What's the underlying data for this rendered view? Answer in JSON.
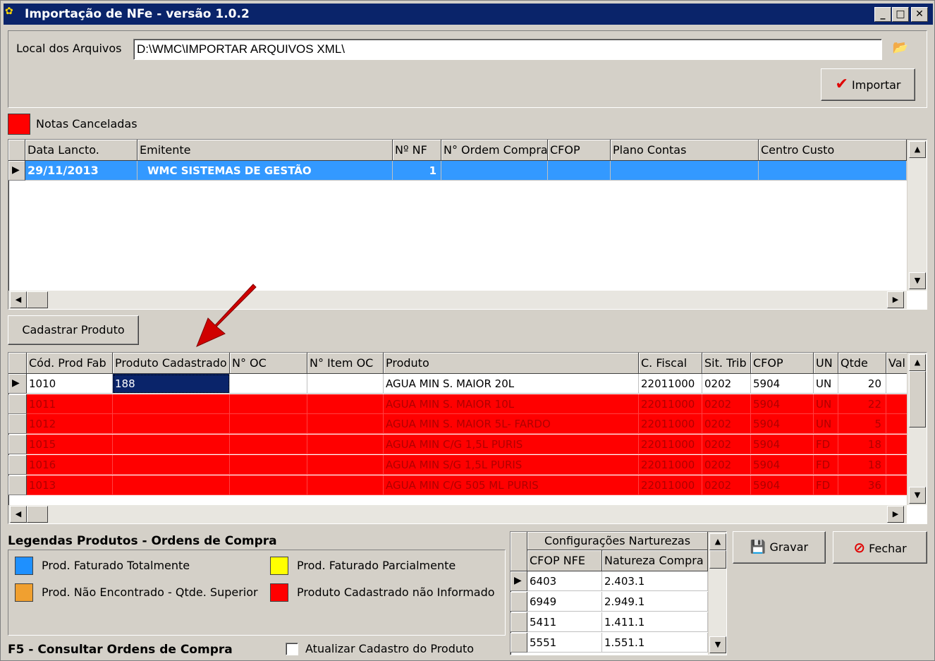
{
  "window": {
    "title": "Importação de NFe - versão 1.0.2",
    "controls": {
      "minimize": "_",
      "maximize": "□",
      "close": "✕"
    }
  },
  "path": {
    "label": "Local dos Arquivos",
    "value": "D:\\WMC\\IMPORTAR ARQUIVOS XML\\"
  },
  "buttons": {
    "importar": "Importar",
    "cadastrar": "Cadastrar Produto",
    "gravar": "Gravar",
    "fechar": "Fechar"
  },
  "canceled_legend": {
    "label": "Notas Canceladas",
    "color": "#ff0000"
  },
  "notes_grid": {
    "columns": [
      "Data Lancto.",
      "Emitente",
      "Nº NF",
      "N° Ordem Compra",
      "CFOP",
      "Plano Contas",
      "Centro Custo"
    ],
    "rows": [
      {
        "data": "29/11/2013",
        "emitente": "WMC SISTEMAS DE GESTÃO",
        "nf": "1",
        "ordem": "",
        "cfop": "",
        "plano": "",
        "centro": ""
      }
    ]
  },
  "products_grid": {
    "columns": [
      "Cód. Prod Fab",
      "Produto Cadastrado",
      "N° OC",
      "N° Item OC",
      "Produto",
      "C. Fiscal",
      "Sit. Trib",
      "CFOP",
      "UN",
      "Qtde",
      "Val"
    ],
    "rows": [
      {
        "cod": "1010",
        "cad": "188",
        "oc": "",
        "item": "",
        "produto": "AGUA MIN S. MAIOR 20L",
        "fiscal": "22011000",
        "sit": "0202",
        "cfop": "5904",
        "un": "UN",
        "qtde": "20"
      },
      {
        "cod": "1011",
        "cad": "",
        "oc": "",
        "item": "",
        "produto": "AGUA MIN S. MAIOR 10L",
        "fiscal": "22011000",
        "sit": "0202",
        "cfop": "5904",
        "un": "UN",
        "qtde": "22"
      },
      {
        "cod": "1012",
        "cad": "",
        "oc": "",
        "item": "",
        "produto": "AGUA MIN S. MAIOR 5L- FARDO",
        "fiscal": "22011000",
        "sit": "0202",
        "cfop": "5904",
        "un": "UN",
        "qtde": "5"
      },
      {
        "cod": "1015",
        "cad": "",
        "oc": "",
        "item": "",
        "produto": "AGUA MIN C/G 1,5L PURIS",
        "fiscal": "22011000",
        "sit": "0202",
        "cfop": "5904",
        "un": "FD",
        "qtde": "18"
      },
      {
        "cod": "1016",
        "cad": "",
        "oc": "",
        "item": "",
        "produto": "AGUA MIN S/G 1,5L PURIS",
        "fiscal": "22011000",
        "sit": "0202",
        "cfop": "5904",
        "un": "FD",
        "qtde": "18"
      },
      {
        "cod": "1013",
        "cad": "",
        "oc": "",
        "item": "",
        "produto": "AGUA MIN C/G 505 ML PURIS",
        "fiscal": "22011000",
        "sit": "0202",
        "cfop": "5904",
        "un": "FD",
        "qtde": "36"
      }
    ]
  },
  "legend": {
    "title": "Legendas Produtos - Ordens de Compra",
    "items": [
      {
        "label": "Prod. Faturado Totalmente",
        "color": "#1e90ff"
      },
      {
        "label": "Prod. Faturado Parcialmente",
        "color": "#ffff00"
      },
      {
        "label": "Prod. Não Encontrado - Qtde. Superior",
        "color": "#f0a030"
      },
      {
        "label": "Produto Cadastrado não Informado",
        "color": "#ff0000"
      }
    ]
  },
  "footer": {
    "hint": "F5 - Consultar Ordens de Compra",
    "checkbox": "Atualizar Cadastro do Produto"
  },
  "config_grid": {
    "title": "Configurações Narturezas",
    "columns": [
      "CFOP NFE",
      "Natureza Compra"
    ],
    "rows": [
      {
        "cfop": "6403",
        "nat": "2.403.1"
      },
      {
        "cfop": "6949",
        "nat": "2.949.1"
      },
      {
        "cfop": "5411",
        "nat": "1.411.1"
      },
      {
        "cfop": "5551",
        "nat": "1.551.1"
      }
    ]
  }
}
